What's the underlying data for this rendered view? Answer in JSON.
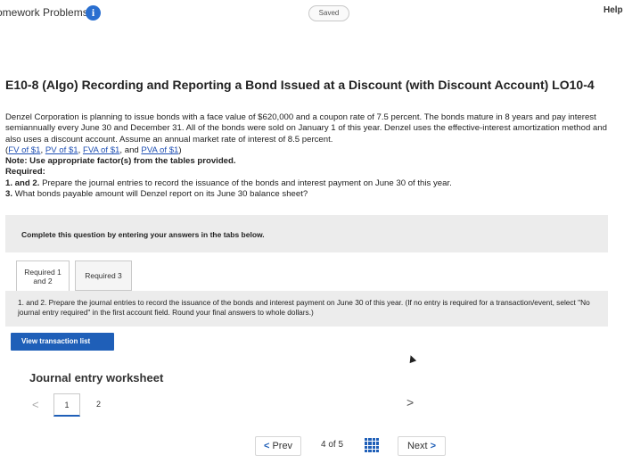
{
  "header": {
    "app_title": "omework Problems",
    "info_glyph": "i",
    "saved_label": "Saved",
    "help_label": "Help"
  },
  "problem": {
    "title": "E10-8 (Algo) Recording and Reporting a Bond Issued at a Discount (with Discount Account) LO10-4",
    "description": "Denzel Corporation is planning to issue bonds with a face value of $620,000 and a coupon rate of 7.5 percent. The bonds mature in 8 years and pay interest semiannually every June 30 and December 31. All of the bonds were sold on January 1 of this year. Denzel uses the effective-interest amortization method and also uses a discount account. Assume an annual market rate of interest of 8.5 percent.",
    "refs": {
      "fv": "FV of $1",
      "pv": "PV of $1",
      "fva": "FVA of $1",
      "and": "and",
      "pva": "PVA of $1"
    },
    "note": "Note: Use appropriate factor(s) from the tables provided.",
    "required_heading": "Required:",
    "req1_num": "1. and 2.",
    "req1_text": "Prepare the journal entries to record the issuance of the bonds and interest payment on June 30 of this year.",
    "req3_num": "3.",
    "req3_text": "What bonds payable amount will Denzel report on its June 30 balance sheet?"
  },
  "complete_box": {
    "text": "Complete this question by entering your answers in the tabs below."
  },
  "tabs": [
    {
      "line1": "Required 1",
      "line2": "and 2",
      "active": true
    },
    {
      "label": "Required 3",
      "active": false
    }
  ],
  "instructions": {
    "text": "1. and 2. Prepare the journal entries to record the issuance of the bonds and interest payment on June 30 of this year. (If no entry is required for a transaction/event, select \"No journal entry required\" in the first account field. Round your final answers to whole dollars.)"
  },
  "view_transaction_button": "View transaction list",
  "journal": {
    "title": "Journal entry worksheet",
    "prev_arrow": "<",
    "page1": "1",
    "page2": "2",
    "next_arrow": ">"
  },
  "bottom_nav": {
    "prev_chev": "<",
    "prev_label": "Prev",
    "current": "4",
    "of": "of",
    "total": "5",
    "next_label": "Next",
    "next_chev": ">"
  },
  "colors": {
    "accent": "#1f5fb8",
    "panel": "#ececec"
  }
}
